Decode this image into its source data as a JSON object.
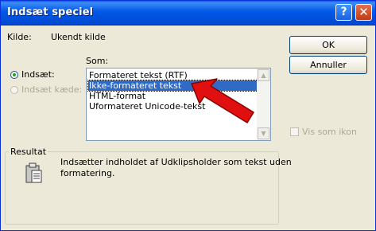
{
  "window": {
    "title": "Indsæt speciel",
    "help_glyph": "?",
    "close_glyph": "✕"
  },
  "source": {
    "label": "Kilde:",
    "value": "Ukendt kilde"
  },
  "as_label": "Som:",
  "options": {
    "paste": {
      "label": "Indsæt:",
      "checked": true
    },
    "paste_link": {
      "label": "Indsæt kæde:",
      "enabled": false
    }
  },
  "formats": [
    {
      "label": "Formateret tekst (RTF)",
      "selected": false
    },
    {
      "label": "Ikke-formateret tekst",
      "selected": true
    },
    {
      "label": "HTML-format",
      "selected": false
    },
    {
      "label": "Uformateret Unicode-tekst",
      "selected": false
    }
  ],
  "buttons": {
    "ok": "OK",
    "cancel": "Annuller"
  },
  "display_as_icon": {
    "label": "Vis som ikon",
    "checked": false,
    "enabled": false
  },
  "result": {
    "title": "Resultat",
    "text_line1": "Indsætter indholdet af Udklipsholder som tekst uden",
    "text_line2": "formatering."
  },
  "scroll": {
    "up_glyph": "▲",
    "down_glyph": "▼"
  },
  "colors": {
    "arrow": "#e01010",
    "selection": "#316ac5",
    "title_bar": "#0058e6"
  },
  "icons": {
    "result": "clipboard-icon",
    "annotation": "red-arrow-annotation"
  }
}
